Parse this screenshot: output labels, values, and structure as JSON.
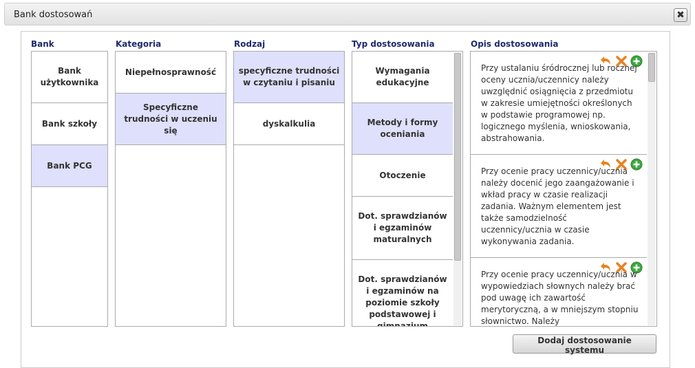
{
  "window": {
    "title": "Bank dostosowań",
    "close_label": "✖"
  },
  "columns": {
    "bank": {
      "header": "Bank",
      "items": [
        {
          "label": "Bank użytkownika",
          "selected": false
        },
        {
          "label": "Bank szkoły",
          "selected": false
        },
        {
          "label": "Bank PCG",
          "selected": true
        }
      ]
    },
    "kategoria": {
      "header": "Kategoria",
      "items": [
        {
          "label": "Niepełnosprawność",
          "selected": false
        },
        {
          "label": "Specyficzne trudności w uczeniu się",
          "selected": true
        }
      ]
    },
    "rodzaj": {
      "header": "Rodzaj",
      "items": [
        {
          "label": "specyficzne trudności w czytaniu i pisaniu",
          "selected": true
        },
        {
          "label": "dyskalkulia",
          "selected": false
        }
      ]
    },
    "typ": {
      "header": "Typ dostosowania",
      "items": [
        {
          "label": "Wymagania edukacyjne",
          "selected": false
        },
        {
          "label": "Metody i formy oceniania",
          "selected": true
        },
        {
          "label": "Otoczenie",
          "selected": false
        },
        {
          "label": "Dot. sprawdzianów i egzaminów maturalnych",
          "selected": false
        },
        {
          "label": "Dot. sprawdzianów i egzaminów na poziomie szkoły podstawowej i gimnazjum",
          "selected": false
        }
      ]
    },
    "opis": {
      "header": "Opis dostosowania",
      "items": [
        {
          "text": "Przy ustalaniu śródrocznej lub rocznej oceny ucznia/uczennicy należy uwzględnić osiągnięcia z przedmiotu w zakresie umiejętności określonych w podstawie programowej np. logicznego myślenia, wnioskowania, abstrahowania."
        },
        {
          "text": "Przy ocenie pracy uczennicy/ucznia należy docenić jego zaangażowanie i wkład pracy w czasie realizacji zadania. Ważnym elementem jest także samodzielność uczennicy/ucznia w czasie wykonywania zadania."
        },
        {
          "text": "Przy ocenie pracy uczennicy/ucznia w wypowiedziach słownych należy brać pod uwagę ich zawartość merytoryczną, a w mniejszym stopniu słownictwo. Należy"
        }
      ]
    }
  },
  "icons": {
    "undo": "undo-arrow-icon",
    "delete": "delete-x-icon",
    "add": "add-plus-icon"
  },
  "colors": {
    "selected": "#dfe0fb",
    "header": "#1e2a6e",
    "undo": "#e8821e",
    "delete": "#e8821e",
    "add": "#3ea83e"
  },
  "footer": {
    "add_button": "Dodaj dostosowanie systemu"
  }
}
